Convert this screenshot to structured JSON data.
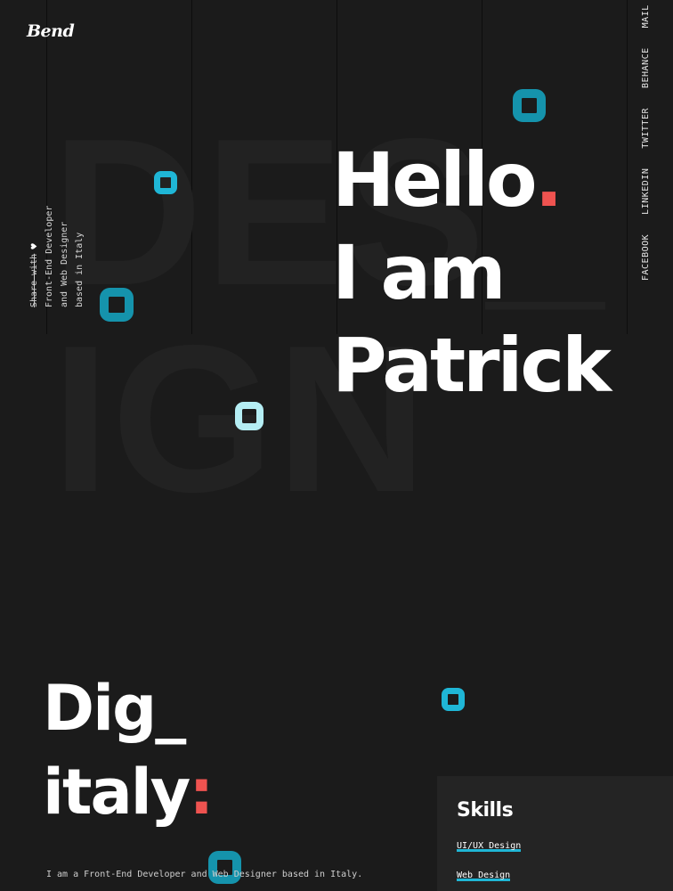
{
  "logo": {
    "text": "Bend"
  },
  "background_words": {
    "line1": "DES_",
    "line2": "IGN"
  },
  "sidebar_left": {
    "share_label": "Share with",
    "share_icon": "heart-icon",
    "tagline_line1": "Front-End Developer",
    "tagline_line2": "and Web Designer",
    "tagline_line3": "based in Italy"
  },
  "social_links": [
    "FACEBOOK",
    "LINKEDIN",
    "TWITTER",
    "BEHANCE",
    "MAIL"
  ],
  "hero": {
    "line1": "Hello",
    "line1_dot": ".",
    "line2": "I am",
    "line3": "Patrick"
  },
  "section": {
    "heading_line1": "Dig_",
    "heading_line2": "italy",
    "heading_colon": ":",
    "intro_text": "I am a Front-End Developer and Web Designer based in Italy."
  },
  "skills": {
    "title": "Skills",
    "items": [
      "UI/UX Design",
      "Web Design"
    ]
  },
  "colors": {
    "background": "#1b1b1b",
    "accent_teal": "#1593ac",
    "accent_cyan": "#1fb6d6",
    "accent_light": "#b5eef4",
    "accent_red": "#ef5350",
    "panel": "#242424"
  }
}
